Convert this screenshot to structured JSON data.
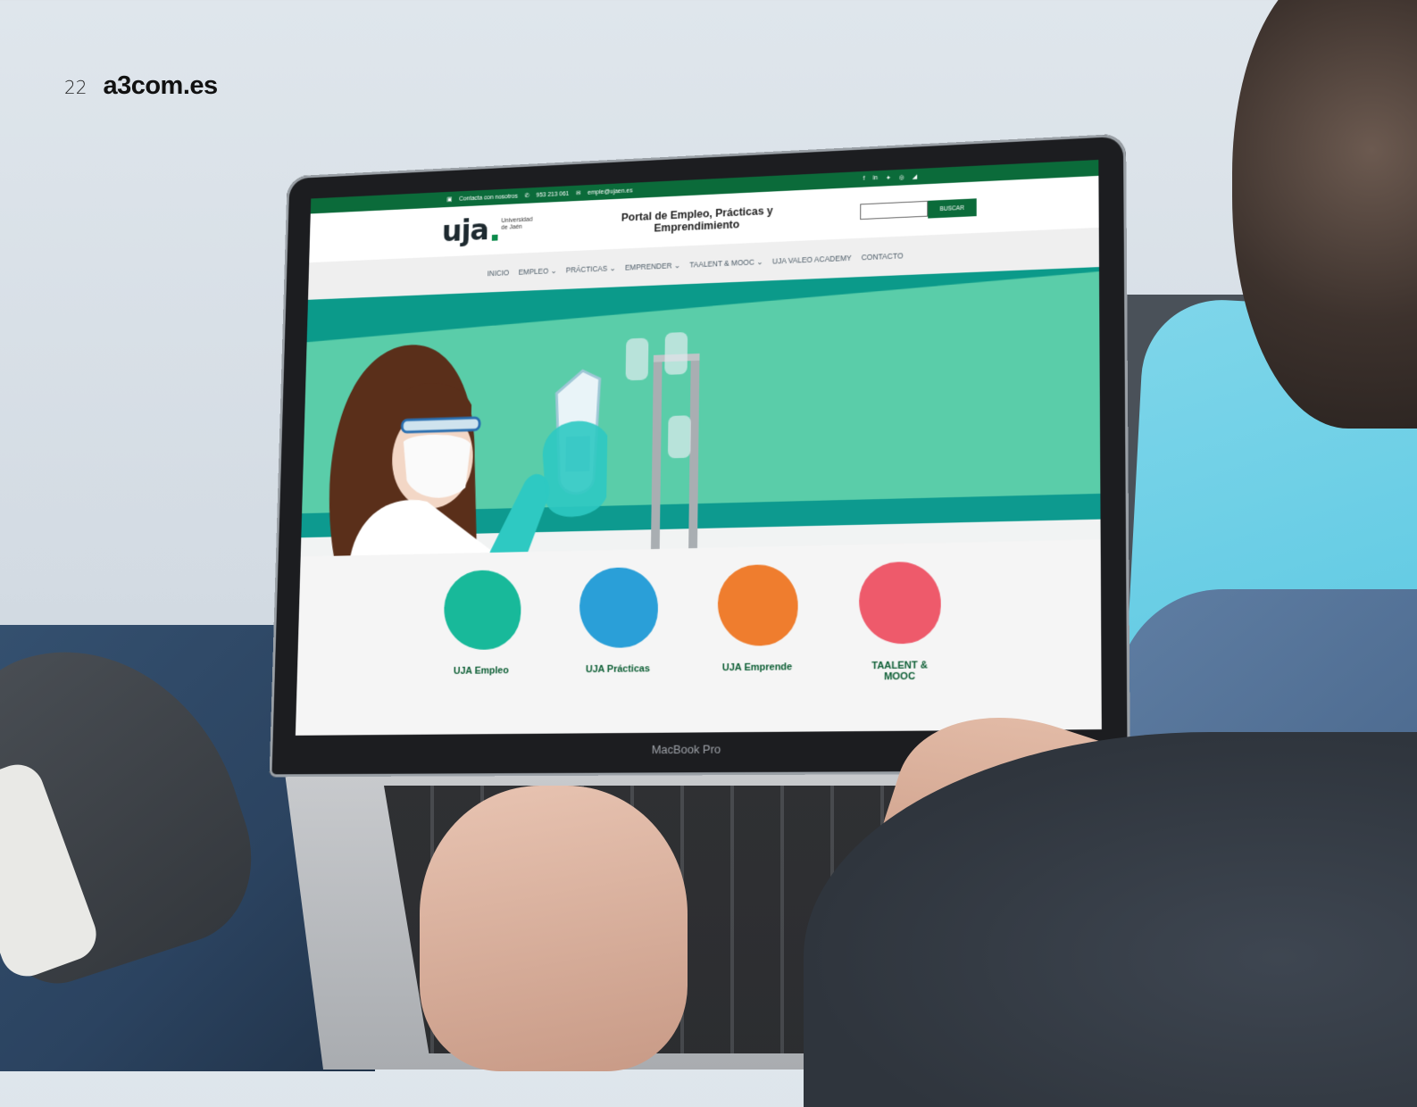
{
  "page": {
    "number": "22",
    "site": "a3com.es"
  },
  "laptop": {
    "model_label": "MacBook Pro"
  },
  "website": {
    "topbar": {
      "contact_label": "Contacta con nosotros",
      "phone": "953 213 061",
      "email": "emple@ujaen.es",
      "social_icons": [
        "facebook-icon",
        "linkedin-icon",
        "twitter-icon",
        "instagram-icon",
        "rss-icon"
      ]
    },
    "logo": {
      "mark": "uja",
      "text_line1": "Universidad",
      "text_line2": "de Jaén"
    },
    "portal_title": "Portal de Empleo, Prácticas y\nEmprendimiento",
    "search": {
      "button_label": "BUSCAR"
    },
    "nav": [
      {
        "label": "INICIO"
      },
      {
        "label": "EMPLEO ⌄"
      },
      {
        "label": "PRÁCTICAS ⌄"
      },
      {
        "label": "EMPRENDER ⌄"
      },
      {
        "label": "TAALENT & MOOC ⌄"
      },
      {
        "label": "UJA VALEO ACADEMY"
      },
      {
        "label": "CONTACTO"
      }
    ],
    "tiles": [
      {
        "label": "UJA Empleo",
        "color": "#18b99a"
      },
      {
        "label": "UJA Prácticas",
        "color": "#2a9fd8"
      },
      {
        "label": "UJA Emprende",
        "color": "#ef7d2e"
      },
      {
        "label": "TAALENT & MOOC",
        "color": "#ee5a6b"
      }
    ]
  },
  "colors": {
    "brand_green": "#0b6b3a",
    "hero": "#5acda9",
    "hero_dark": "#0d9a8f"
  }
}
